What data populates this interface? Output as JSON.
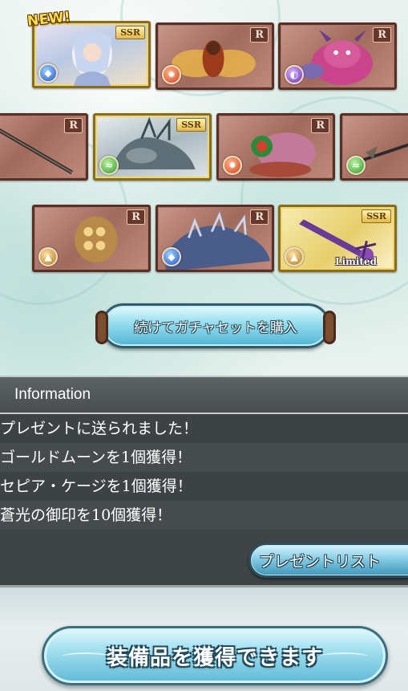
{
  "new_badge": "NEW!",
  "cards": [
    {
      "id": "c1",
      "rarity": "SSR",
      "element": "water",
      "kind": "char"
    },
    {
      "id": "c2",
      "rarity": "R",
      "element": "fire",
      "kind": "r"
    },
    {
      "id": "c3",
      "rarity": "R",
      "element": "dark",
      "kind": "r"
    },
    {
      "id": "c4",
      "rarity": "R",
      "element": "",
      "kind": "r"
    },
    {
      "id": "c5",
      "rarity": "SSR",
      "element": "wind",
      "kind": "char"
    },
    {
      "id": "c6",
      "rarity": "R",
      "element": "fire",
      "kind": "r"
    },
    {
      "id": "c7",
      "rarity": "R",
      "element": "wind",
      "kind": "r"
    },
    {
      "id": "c8",
      "rarity": "R",
      "element": "earth",
      "kind": "r"
    },
    {
      "id": "c9",
      "rarity": "R",
      "element": "water",
      "kind": "r"
    },
    {
      "id": "c10",
      "rarity": "SSR",
      "element": "earth",
      "kind": "weapon",
      "label": "Limited"
    }
  ],
  "buttons": {
    "continue_label": "続けてガチャセットを購入",
    "present_list_label": "プレゼントリスト",
    "equip_label": "装備品を獲得できます"
  },
  "information": {
    "title": "Information",
    "lines": [
      "プレゼントに送られました！",
      "ゴールドムーンを1個獲得！",
      "セピア・ケージを1個獲得！",
      "蒼光の御印を10個獲得！"
    ]
  },
  "colors": {
    "r_card": "#a06a5c",
    "ssr_frame": "#f1d56d",
    "panel_bg": "#3f4446",
    "button_blue": "#7ec7e0"
  }
}
